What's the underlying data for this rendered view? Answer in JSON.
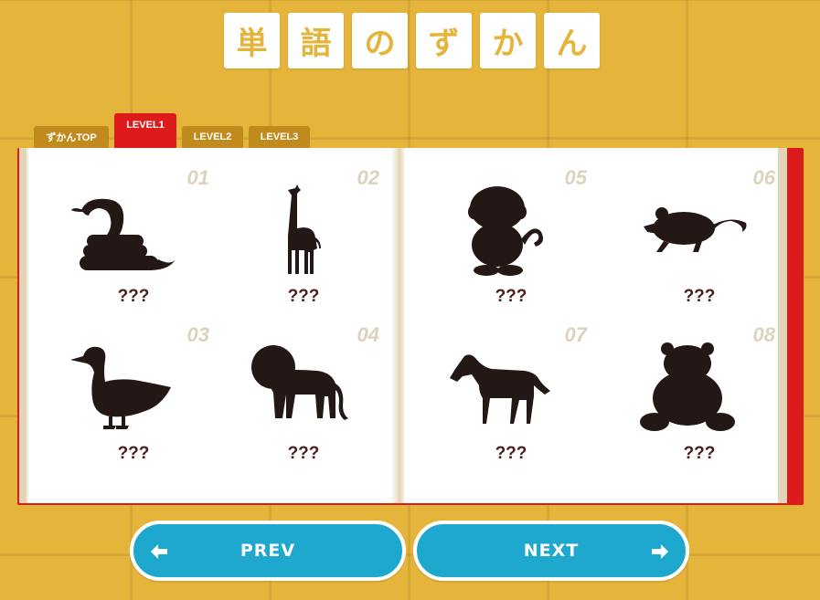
{
  "title": {
    "chars": [
      "単",
      "語",
      "の",
      "ず",
      "か",
      "ん"
    ]
  },
  "tabs": [
    {
      "label": "ずかんTOP",
      "active": false
    },
    {
      "label": "LEVEL1",
      "active": true
    },
    {
      "label": "LEVEL2",
      "active": false
    },
    {
      "label": "LEVEL3",
      "active": false
    }
  ],
  "cards": [
    {
      "number": "01",
      "name": "???",
      "icon": "snake-silhouette-icon"
    },
    {
      "number": "02",
      "name": "???",
      "icon": "giraffe-silhouette-icon"
    },
    {
      "number": "03",
      "name": "???",
      "icon": "duck-silhouette-icon"
    },
    {
      "number": "04",
      "name": "???",
      "icon": "lion-silhouette-icon"
    },
    {
      "number": "05",
      "name": "???",
      "icon": "monkey-silhouette-icon"
    },
    {
      "number": "06",
      "name": "???",
      "icon": "mouse-silhouette-icon"
    },
    {
      "number": "07",
      "name": "???",
      "icon": "horse-silhouette-icon"
    },
    {
      "number": "08",
      "name": "???",
      "icon": "bear-silhouette-icon"
    }
  ],
  "nav": {
    "prev_label": "PREV",
    "next_label": "NEXT"
  },
  "colors": {
    "background": "#e5b43a",
    "tab": "#c08b1c",
    "tab_active": "#dd1a1c",
    "book_cover": "#dd1a1c",
    "silhouette": "#231816",
    "card_name": "#4a1e1a",
    "nav_button": "#1fa8cd"
  }
}
